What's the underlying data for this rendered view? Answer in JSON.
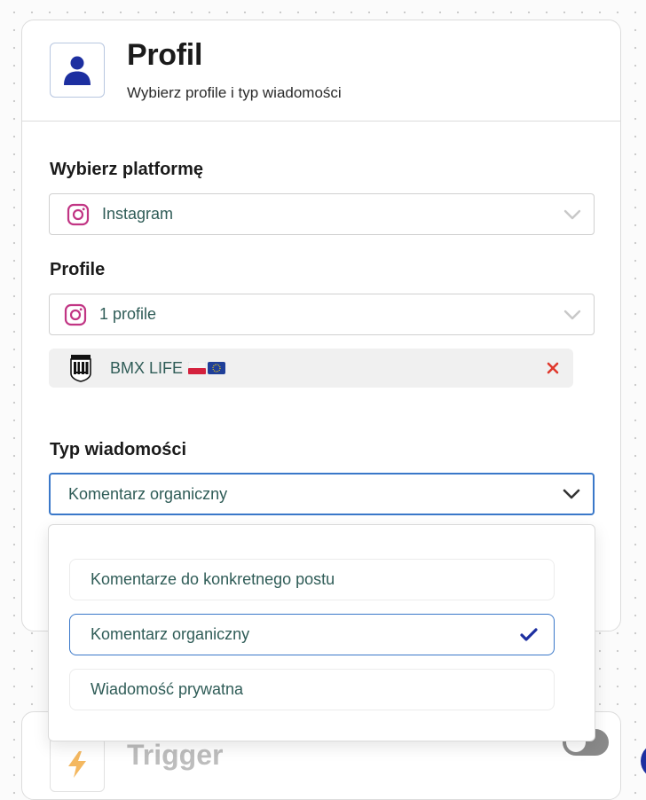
{
  "colors": {
    "accent_blue": "#1d2fa0",
    "focus_border": "#3a78c9",
    "instagram_pink": "#c13584",
    "remove_red": "#e0382c",
    "text_teal": "#2f5c57"
  },
  "profile_card": {
    "icon": "user-icon",
    "title": "Profil",
    "subtitle": "Wybierz profile i typ wiadomości"
  },
  "platform": {
    "label": "Wybierz platformę",
    "icon": "instagram-icon",
    "selected": "Instagram"
  },
  "profiles": {
    "label": "Profile",
    "icon": "instagram-icon",
    "selected": "1 profile",
    "chips": [
      {
        "name": "BMX LIFE",
        "flags": [
          "flag-poland-icon",
          "flag-eu-icon"
        ],
        "remove_icon": "close-icon"
      }
    ]
  },
  "message_type": {
    "label": "Typ wiadomości",
    "selected": "Komentarz organiczny",
    "options": [
      {
        "label": "Komentarze do konkretnego postu",
        "selected": false
      },
      {
        "label": "Komentarz organiczny",
        "selected": true
      },
      {
        "label": "Wiadomość prywatna",
        "selected": false
      }
    ]
  },
  "trigger_card": {
    "icon": "lightning-icon",
    "title": "Trigger",
    "toggle_on": false
  }
}
